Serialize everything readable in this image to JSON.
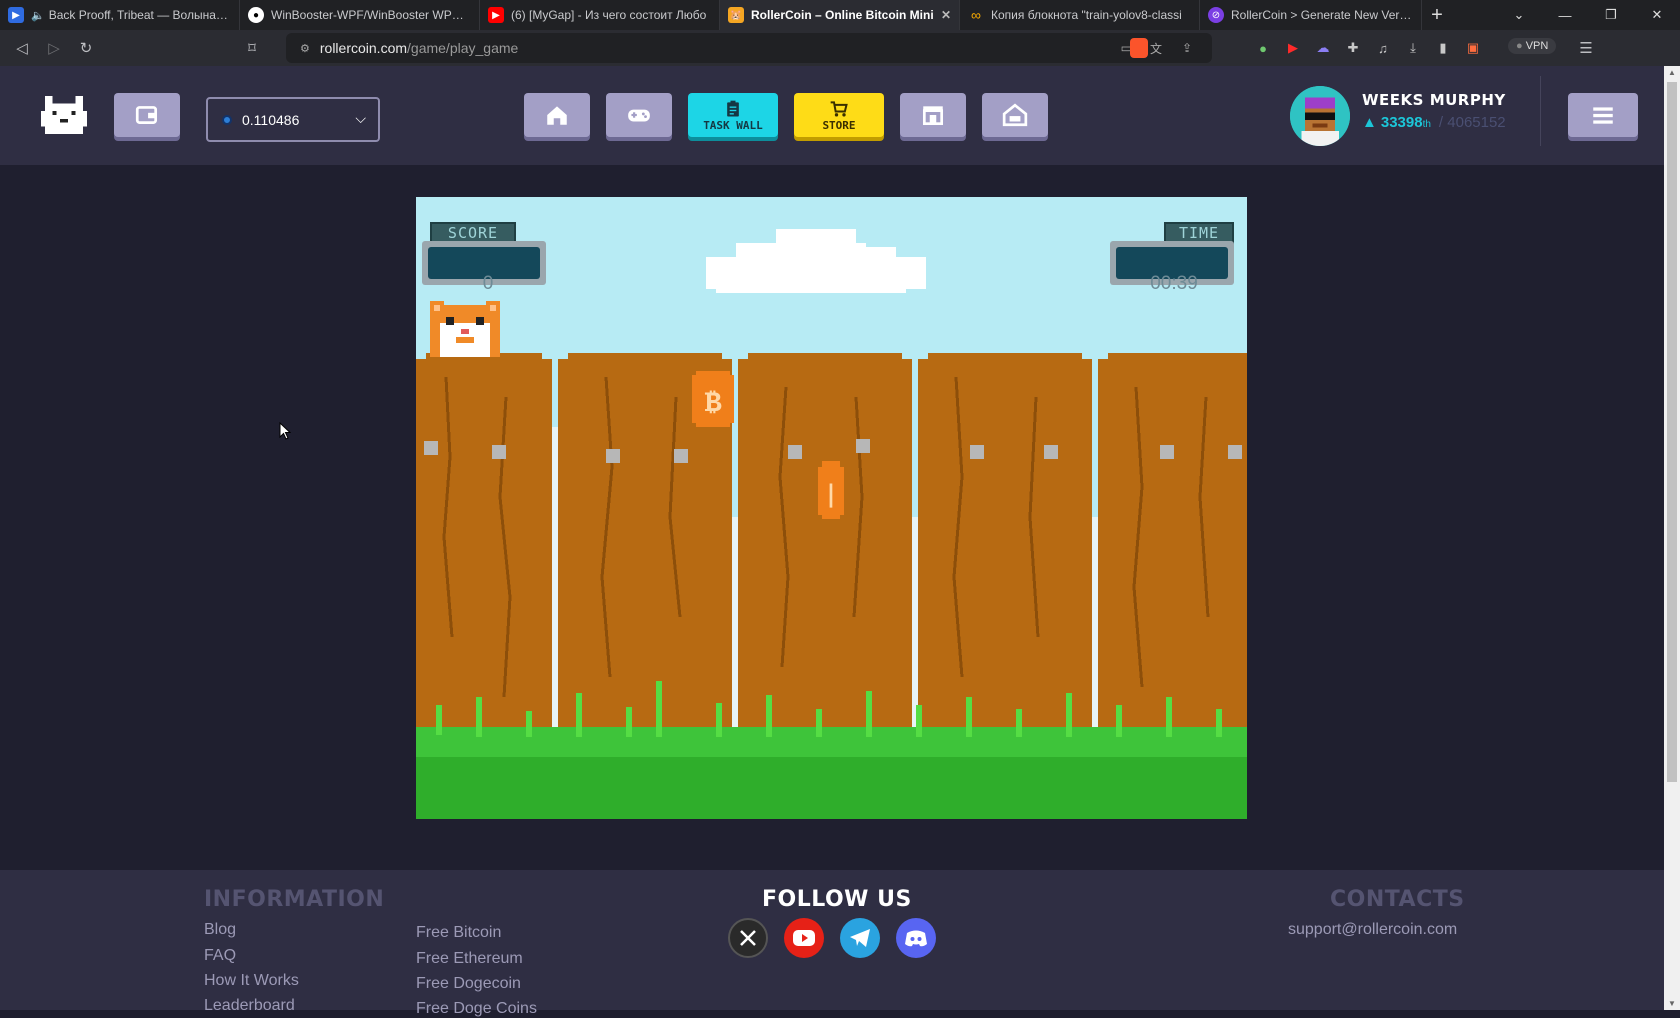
{
  "browser": {
    "tabs": [
      {
        "title": "Back Prooff, Tribeat — Волына (Sp",
        "favicon_color": "#2f6be0",
        "active": false
      },
      {
        "title": "WinBooster-WPF/WinBooster WPF/Fo",
        "favicon_color": "#ffffff",
        "active": false
      },
      {
        "title": "(6) [MyGap] - Из чего состоит Любо",
        "favicon_color": "#ff0000",
        "active": false
      },
      {
        "title": "RollerCoin – Online Bitcoin Mini",
        "favicon_color": "#f5a623",
        "active": true
      },
      {
        "title": "Копия блокнота \"train-yolov8-classi",
        "favicon_color": "#f9ab00",
        "active": false
      },
      {
        "title": "RollerCoin > Generate New Version >",
        "favicon_color": "#7b3fe4",
        "active": false
      }
    ],
    "url_host": "rollercoin.com",
    "url_path": "/game/play_game",
    "vpn_label": "VPN"
  },
  "header": {
    "balance": "0.110486",
    "task_wall_label": "TASK WALL",
    "store_label": "STORE",
    "username": "WEEKS MURPHY",
    "rank": "33398",
    "rank_suffix": "th",
    "rank_total": "/ 4065152",
    "colors": {
      "task": "#1dd5e6",
      "store": "#fedc17",
      "button": "#a39fc6"
    }
  },
  "game": {
    "score_label": "SCORE",
    "score_value": "0",
    "time_label": "TIME",
    "time_value": "00:39"
  },
  "footer": {
    "information_title": "INFORMATION",
    "follow_title": "FOLLOW US",
    "contacts_title": "CONTACTS",
    "links_col1": [
      "Blog",
      "FAQ",
      "How It Works",
      "Leaderboard"
    ],
    "links_col2": [
      "Free Bitcoin",
      "Free Ethereum",
      "Free Dogecoin",
      "Free Doge Coins"
    ],
    "email": "support@rollercoin.com",
    "socials": [
      "x-icon",
      "youtube-icon",
      "telegram-icon",
      "discord-icon"
    ]
  }
}
